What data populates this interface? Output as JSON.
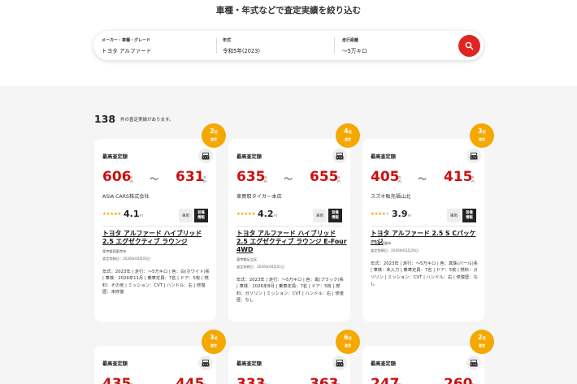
{
  "heading": "車種・年式などで査定実績を絞り込む",
  "search": {
    "fields": [
      {
        "label": "メーカー・車種・グレード",
        "value": "トヨタ アルファード"
      },
      {
        "label": "年式",
        "value": "令和5年(2023)"
      },
      {
        "label": "走行距離",
        "value": "〜5万キロ"
      }
    ]
  },
  "results": {
    "count": "138",
    "suffix": "件の査定実績があります。"
  },
  "colors": {
    "accent_red": "#cc0f0f",
    "badge_orange": "#f5a800",
    "button_red": "#e02424"
  },
  "labels": {
    "max_price": "最高査定額",
    "unit_top": "万",
    "unit_bottom": "円",
    "tilde": "〜",
    "pt": "PT",
    "car_tag": "車両",
    "eq_tag_1": "装備",
    "eq_tag_2": "情報",
    "rank_suffix": "位",
    "rank_label": "査定"
  },
  "cards": [
    {
      "rank": "2",
      "min": "606",
      "max": "631",
      "shop": "ASIA CARS株式会社",
      "stars": 4.5,
      "rating": "4.1",
      "title": "トヨタ アルファード ハイブリッド 2.5 エグゼクティブ ラウンジ",
      "location": "東京都西東京市",
      "date": "査定依頼日：2026年04月03日",
      "spec": "年式：2023年 | 走行：〜5万キロ | 色：白(ホワイト)系 | 車検：2026年11月 | 乗車定員：7名 | ドア：5枚 | 燃料：その他 | ミッション：CVT | ハンドル：右 | 修復歴：未修復"
    },
    {
      "rank": "4",
      "min": "635",
      "max": "655",
      "shop": "車買取タイガー本店",
      "stars": 4.5,
      "rating": "4.2",
      "title": "トヨタ アルファード ハイブリッド 2.5 エグゼクティブ ラウンジ E-Four 4WD",
      "location": "東京都足立区",
      "date": "査定依頼日：2026年04月01日",
      "spec": "年式：2023年 | 走行：〜5万キロ | 色：黒(ブラック)系 | 車検：2026年8月 | 乗車定員：7名 | ドア：5枚 | 燃料：ガソリン | ミッション：CVT | ハンドル：右 | 修復歴：なし"
    },
    {
      "rank": "3",
      "min": "405",
      "max": "415",
      "shop": "スズキ販売福山北",
      "stars": 4,
      "rating": "3.9",
      "title": "トヨタ アルファード 2.5 S Cパッケージ",
      "location": "広島県尾道市",
      "date": "査定依頼日：2026年03月29日",
      "spec": "年式：2023年 | 走行：〜5万キロ | 色：真珠(パール)系 | 車検：未入力 | 乗車定員：7名 | ドア：5枚 | 燃料：ガソリン | ミッション：CVT | ハンドル：右 | 修復歴：なし"
    },
    {
      "rank": "3",
      "min": "435",
      "max": "445"
    },
    {
      "rank": "6",
      "min": "333",
      "max": "363"
    },
    {
      "rank": "2",
      "min": "247",
      "max": "260"
    }
  ]
}
